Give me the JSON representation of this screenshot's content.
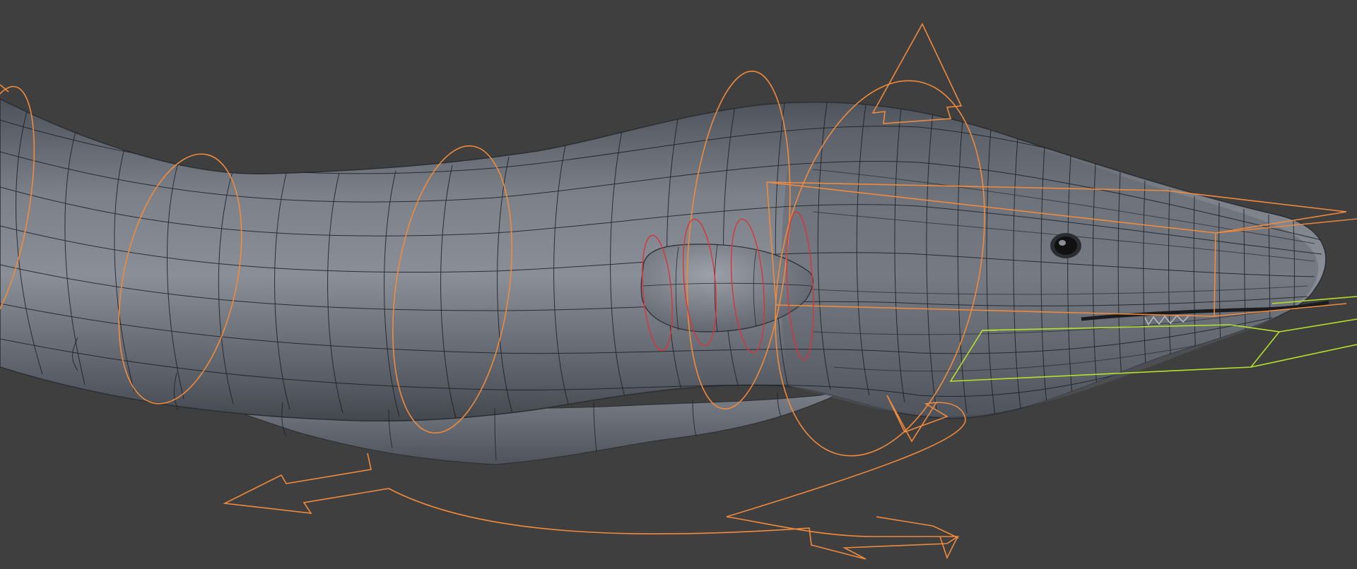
{
  "viewport": {
    "background": "#3f3f3f",
    "object": "eel-mesh",
    "shading": "solid",
    "wireframe_overlay": true
  },
  "colors": {
    "mesh_fill": "#6b7078",
    "mesh_highlight": "#8e939b",
    "mesh_shadow": "#454a52",
    "wire": "#1b1e22",
    "rig_control": "#f08a3c",
    "fk_control": "#d8343c",
    "jaw_control": "#b6e02c",
    "eye": "#111111"
  },
  "rig": {
    "spine_controls": 5,
    "pectoral_fin_controls": 4,
    "has_root_arrows": true,
    "has_head_box": true,
    "has_jaw_box": true
  }
}
